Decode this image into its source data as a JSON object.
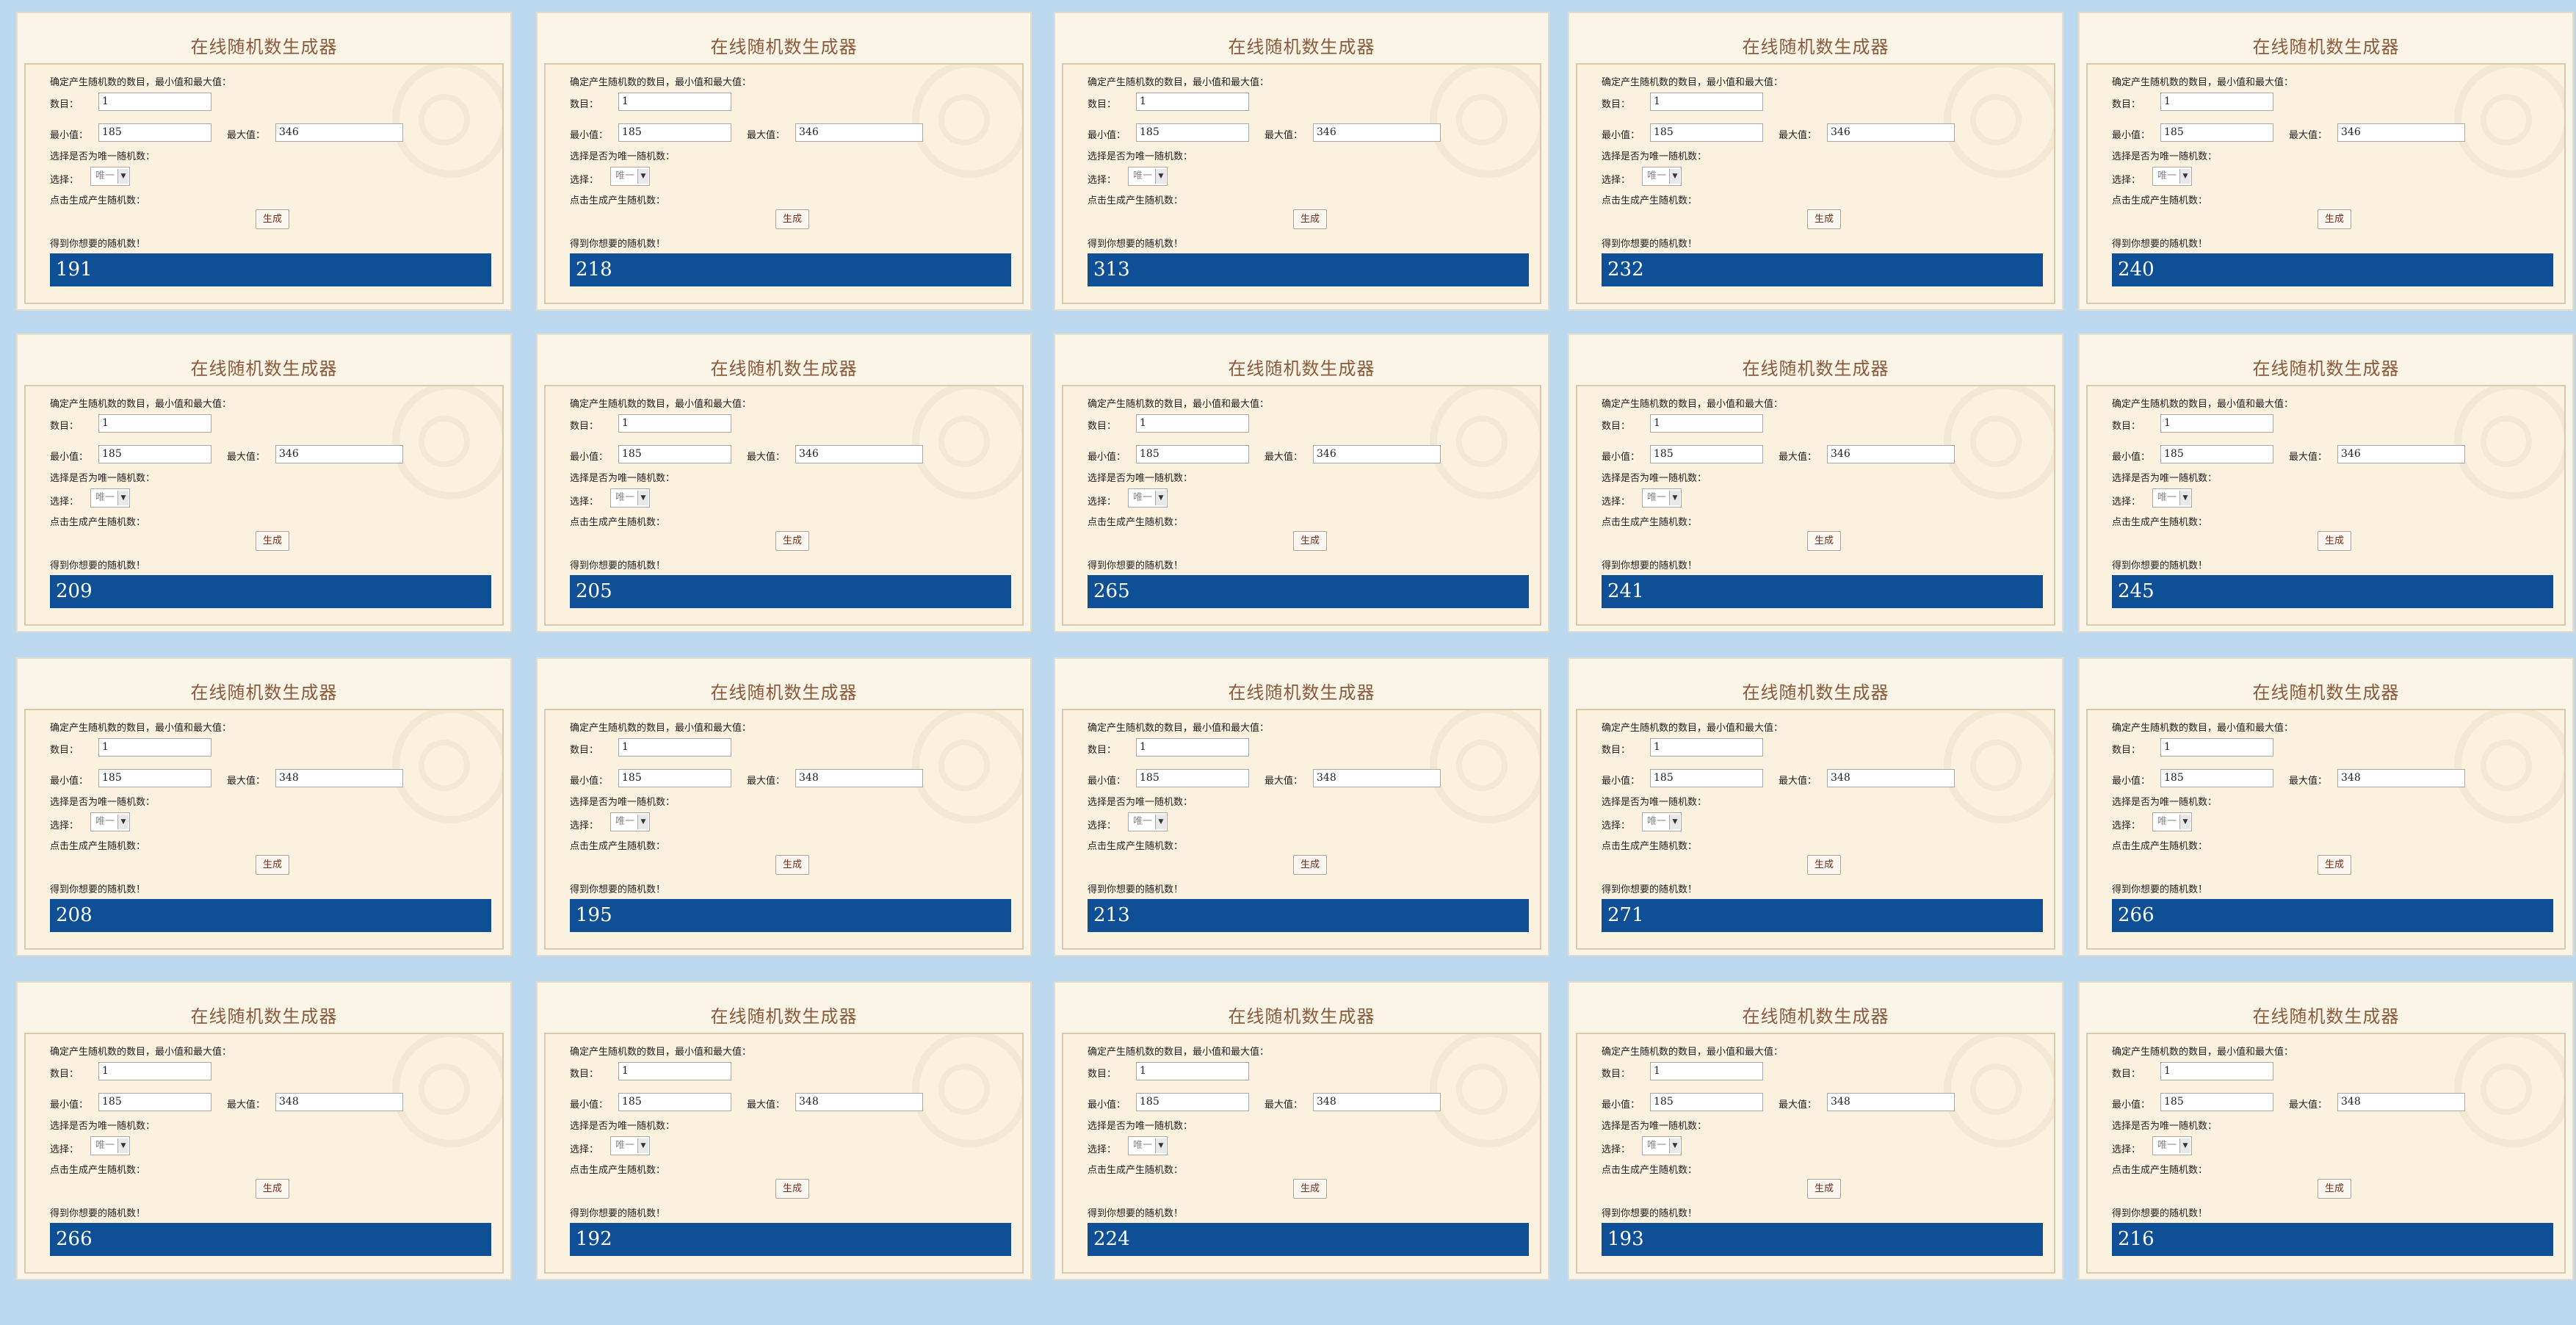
{
  "labels": {
    "title": "在线随机数生成器",
    "intro": "确定产生随机数的数目，最小值和最大值：",
    "count": "数目：",
    "min": "最小值：",
    "max": "最大值：",
    "unique_q": "选择是否为唯一随机数：",
    "choose": "选择：",
    "click_hint": "点击生成产生随机数：",
    "generate": "生成",
    "result_hint": "得到你想要的随机数！"
  },
  "panels": [
    {
      "count": "1",
      "min": "185",
      "max": "346",
      "unique": "唯一",
      "result": "191"
    },
    {
      "count": "1",
      "min": "185",
      "max": "346",
      "unique": "唯一",
      "result": "218"
    },
    {
      "count": "1",
      "min": "185",
      "max": "346",
      "unique": "唯一",
      "result": "313"
    },
    {
      "count": "1",
      "min": "185",
      "max": "346",
      "unique": "唯一",
      "result": "232"
    },
    {
      "count": "1",
      "min": "185",
      "max": "346",
      "unique": "唯一",
      "result": "240"
    },
    {
      "count": "1",
      "min": "185",
      "max": "346",
      "unique": "唯一",
      "result": "209"
    },
    {
      "count": "1",
      "min": "185",
      "max": "346",
      "unique": "唯一",
      "result": "205"
    },
    {
      "count": "1",
      "min": "185",
      "max": "346",
      "unique": "唯一",
      "result": "265"
    },
    {
      "count": "1",
      "min": "185",
      "max": "346",
      "unique": "唯一",
      "result": "241"
    },
    {
      "count": "1",
      "min": "185",
      "max": "346",
      "unique": "唯一",
      "result": "245"
    },
    {
      "count": "1",
      "min": "185",
      "max": "348",
      "unique": "唯一",
      "result": "208"
    },
    {
      "count": "1",
      "min": "185",
      "max": "348",
      "unique": "唯一",
      "result": "195"
    },
    {
      "count": "1",
      "min": "185",
      "max": "348",
      "unique": "唯一",
      "result": "213"
    },
    {
      "count": "1",
      "min": "185",
      "max": "348",
      "unique": "唯一",
      "result": "271"
    },
    {
      "count": "1",
      "min": "185",
      "max": "348",
      "unique": "唯一",
      "result": "266"
    },
    {
      "count": "1",
      "min": "185",
      "max": "348",
      "unique": "唯一",
      "result": "266"
    },
    {
      "count": "1",
      "min": "185",
      "max": "348",
      "unique": "唯一",
      "result": "192"
    },
    {
      "count": "1",
      "min": "185",
      "max": "348",
      "unique": "唯一",
      "result": "224"
    },
    {
      "count": "1",
      "min": "185",
      "max": "348",
      "unique": "唯一",
      "result": "193"
    },
    {
      "count": "1",
      "min": "185",
      "max": "348",
      "unique": "唯一",
      "result": "216"
    }
  ]
}
